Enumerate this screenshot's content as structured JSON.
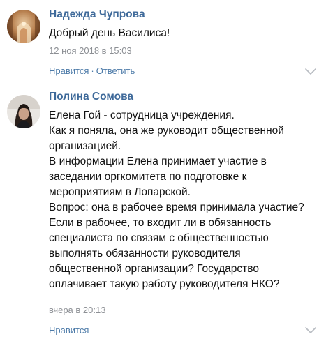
{
  "comments": [
    {
      "author": "Надежда Чупрова",
      "lines": [
        "Добрый день Василиса!"
      ],
      "date": "12 ноя 2018 в 15:03",
      "like_label": "Нравится",
      "separator": "·",
      "reply_label": "Ответить",
      "avatar_icon": "church-photo-avatar",
      "chevron_icon": "chevron-down-icon"
    },
    {
      "author": "Полина Сомова",
      "lines": [
        "Елена Гой - сотрудница учреждения.",
        "Как я поняла, она же руководит общественной",
        "организацией.",
        "В информации Елена принимает участие в",
        "заседании оргкомитета по подготовке к",
        "мероприятиям в Лопарской.",
        "Вопрос: она в рабочее время принимала участие?",
        "Если в рабочее, то входит ли в обязанность",
        "специалиста по связям с общественностью",
        "выполнять обязанности руководителя",
        "общественной организации? Государство",
        "оплачивает такую работу руководителя НКО?"
      ],
      "date": "вчера в 20:13",
      "like_label": "Нравится",
      "avatar_icon": "woman-photo-avatar",
      "chevron_icon": "chevron-down-icon"
    }
  ],
  "colors": {
    "author": "#3f6a9a",
    "link": "#4c7aa8",
    "meta": "#8c8f94",
    "text": "#111111",
    "divider": "#e3e6ea"
  }
}
